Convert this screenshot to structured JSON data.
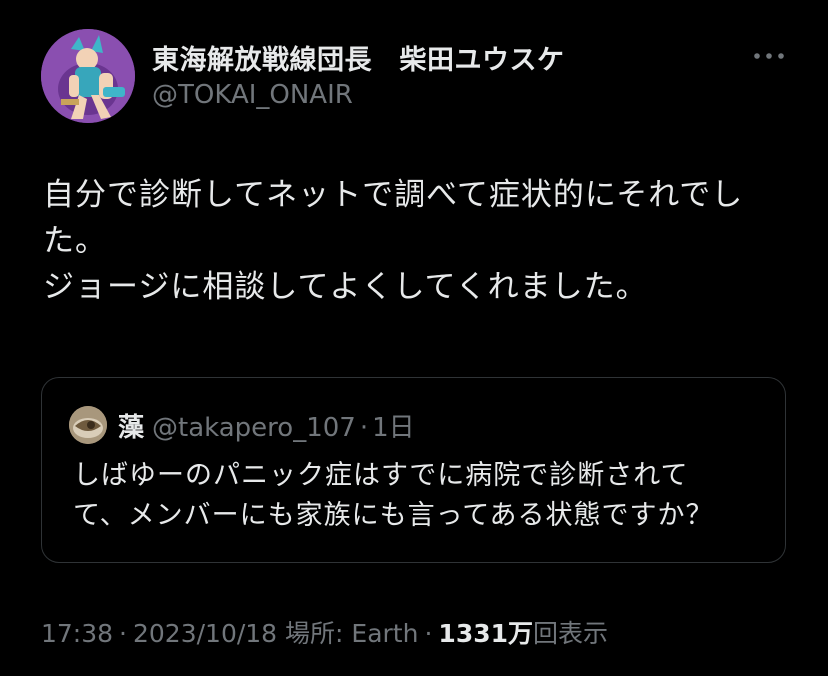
{
  "author": {
    "display_name": "東海解放戦線団長　柴田ユウスケ",
    "handle": "@TOKAI_ONAIR",
    "avatar_icon": "user-avatar-photo"
  },
  "more_icon": "ellipsis-horizontal-icon",
  "tweet": {
    "lines": [
      "自分で診断してネットで調べて症状的にそれでし",
      "た。",
      "ジョージに相談してよくしてくれました。"
    ]
  },
  "quote": {
    "display_name": "藻",
    "handle": "@takapero_107",
    "separator": "·",
    "time": "1日",
    "lines": [
      "しばゆーのパニック症はすでに病院で診断されて",
      "て、メンバーにも家族にも言ってある状態ですか？"
    ]
  },
  "meta": {
    "time": "17:38",
    "sep1": "·",
    "date": "2023/10/18",
    "location": "場所: Earth",
    "sep3": "·",
    "views_count": "1331万",
    "views_label": "回表示"
  },
  "colors": {
    "background": "#000000",
    "text_primary": "#e7e9ea",
    "text_secondary": "#71767b",
    "border": "#2f3336"
  }
}
